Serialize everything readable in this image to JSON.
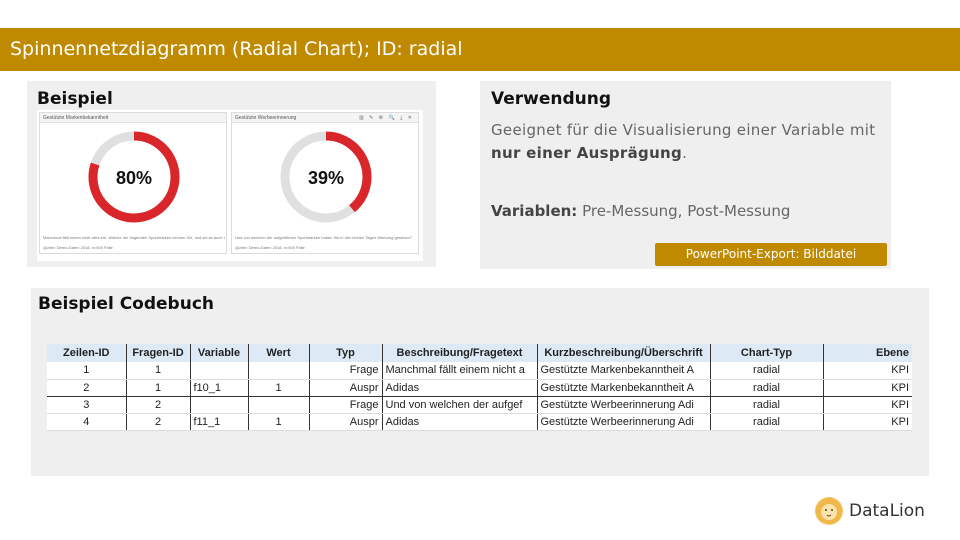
{
  "title": "Spinnennetzdiagramm (Radial Chart); ID: radial",
  "beispiel": {
    "heading": "Beispiel",
    "cards": [
      {
        "title": "Gestützte Markenbekanntheit",
        "value_label": "80%",
        "value": 0.8,
        "question": "Manchmal fällt einem nicht alles ein. Welche der folgenden Sportmarken kennen Sie, und sei es auch nur dem ...",
        "source": "Quelle: Demo-Daten 2018, n=500 Fälle"
      },
      {
        "title": "Gestützte Werbeerinnerung",
        "value_label": "39%",
        "value": 0.39,
        "question": "Und von welchen der aufgeführten Sportmarken haben Sie in den letzten Tagen Werbung gesehen?",
        "source": "Quelle: Demo-Daten 2018, n=500 Fälle",
        "tools": "▥ ✎ ⚙ 🔍 ⤓ ✕"
      }
    ],
    "colors": {
      "arc": "#d9262a",
      "track": "#e0e0e0"
    }
  },
  "verwendung": {
    "heading": "Verwendung",
    "text_before": "Geeignet für die Visualisierung einer Variable mit ",
    "text_bold": "nur einer Ausprägung",
    "text_after": ".",
    "variablen_label": "Variablen:",
    "variablen_value": " Pre-Messung, Post-Messung",
    "export_label": "PowerPoint-Export: Bilddatei"
  },
  "codebuch": {
    "heading": "Beispiel Codebuch",
    "columns": [
      "Zeilen-ID",
      "Fragen-ID",
      "Variable",
      "Wert",
      "Typ",
      "Beschreibung/Fragetext",
      "Kurzbeschreibung/Überschrift",
      "Chart-Typ",
      "Ebene"
    ],
    "rows": [
      [
        "1",
        "1",
        "",
        "",
        "Frage",
        "Manchmal fällt einem nicht a",
        "Gestützte Markenbekanntheit A",
        "radial",
        "KPI"
      ],
      [
        "2",
        "1",
        "f10_1",
        "1",
        "Auspr",
        "Adidas",
        "Gestützte Markenbekanntheit A",
        "radial",
        "KPI"
      ],
      [
        "3",
        "2",
        "",
        "",
        "Frage",
        "Und von welchen der aufgef",
        "Gestützte Werbeerinnerung Adi",
        "radial",
        "KPI"
      ],
      [
        "4",
        "2",
        "f11_1",
        "1",
        "Auspr",
        "Adidas",
        "Gestützte Werbeerinnerung Adi",
        "radial",
        "KPI"
      ]
    ]
  },
  "logo": {
    "text": "DataLion"
  }
}
